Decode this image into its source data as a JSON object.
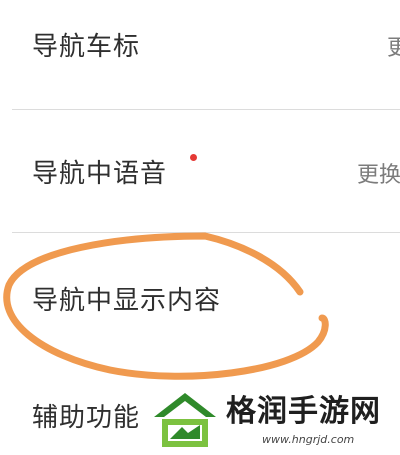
{
  "settings": {
    "items": [
      {
        "label": "导航车标",
        "value": "更"
      },
      {
        "label": "导航中语音",
        "value": "更换",
        "has_new_dot": true
      },
      {
        "label": "导航中显示内容"
      },
      {
        "label": "辅助功能"
      }
    ]
  },
  "annotation": {
    "circle_color": "#f09a4f",
    "circled_item": "导航中显示内容"
  },
  "watermark": {
    "site_name": "格润手游网",
    "url": "www.hngrjd.com",
    "logo_colors": [
      "#2f8a2a",
      "#7cc240"
    ]
  },
  "colors": {
    "new_dot": "#e53935",
    "divider": "#dcdcdc"
  }
}
